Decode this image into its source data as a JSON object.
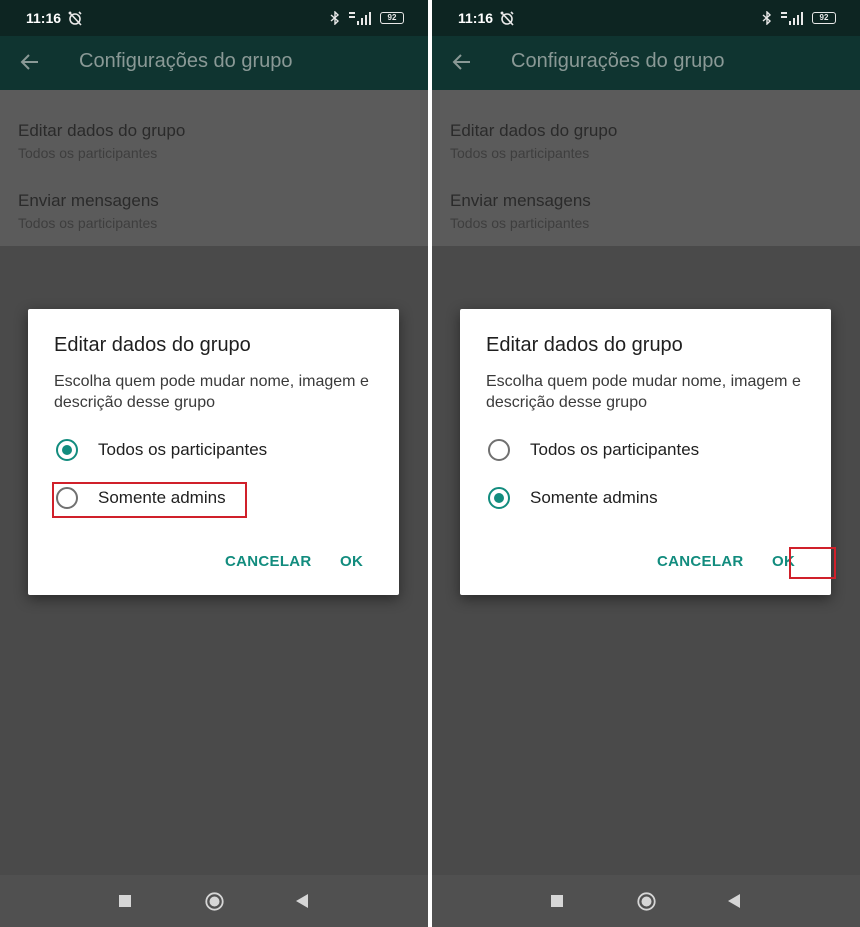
{
  "screens": [
    {
      "status": {
        "time": "11:16",
        "battery": "92"
      },
      "appbar": {
        "title": "Configurações do grupo"
      },
      "settings": [
        {
          "title": "Editar dados do grupo",
          "subtitle": "Todos os participantes"
        },
        {
          "title": "Enviar mensagens",
          "subtitle": "Todos os participantes"
        }
      ],
      "dialog": {
        "title": "Editar dados do grupo",
        "description": "Escolha quem pode mudar nome, imagem e descrição desse grupo",
        "options": [
          {
            "label": "Todos os participantes",
            "selected": true
          },
          {
            "label": "Somente admins",
            "selected": false
          }
        ],
        "cancel": "CANCELAR",
        "ok": "OK",
        "highlighted": "Somente admins"
      }
    },
    {
      "status": {
        "time": "11:16",
        "battery": "92"
      },
      "appbar": {
        "title": "Configurações do grupo"
      },
      "settings": [
        {
          "title": "Editar dados do grupo",
          "subtitle": "Todos os participantes"
        },
        {
          "title": "Enviar mensagens",
          "subtitle": "Todos os participantes"
        }
      ],
      "dialog": {
        "title": "Editar dados do grupo",
        "description": "Escolha quem pode mudar nome, imagem e descrição desse grupo",
        "options": [
          {
            "label": "Todos os participantes",
            "selected": false
          },
          {
            "label": "Somente admins",
            "selected": true
          }
        ],
        "cancel": "CANCELAR",
        "ok": "OK",
        "highlighted": "OK"
      }
    }
  ],
  "colors": {
    "accent": "#128c7e",
    "appbar": "#0f3430",
    "highlight": "#d0202a"
  },
  "icons": {
    "status": [
      "alarm-off-icon",
      "bluetooth-icon",
      "signal-icon",
      "battery-icon"
    ],
    "appbar": "back-arrow-icon",
    "navbar": [
      "recents-square-icon",
      "home-circle-icon",
      "back-triangle-icon"
    ]
  }
}
